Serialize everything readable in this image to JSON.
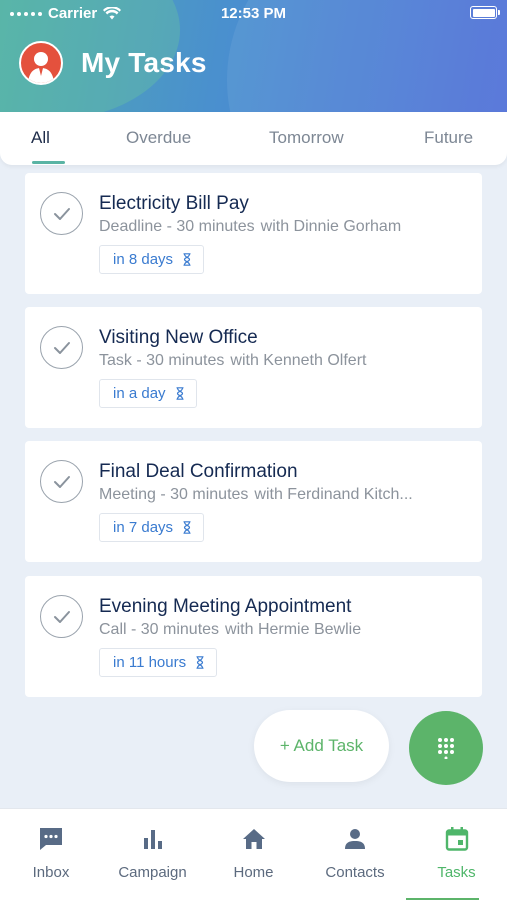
{
  "status_bar": {
    "carrier": "Carrier",
    "time": "12:53 PM"
  },
  "header": {
    "title": "My Tasks"
  },
  "tabs": [
    {
      "label": "All",
      "active": true
    },
    {
      "label": "Overdue",
      "active": false
    },
    {
      "label": "Tomorrow",
      "active": false
    },
    {
      "label": "Future",
      "active": false
    }
  ],
  "tasks": [
    {
      "title": "Electricity Bill Pay",
      "type_duration": "Deadline - 30 minutes",
      "with": "with Dinnie Gorham",
      "due": "in 8 days"
    },
    {
      "title": "Visiting New Office",
      "type_duration": "Task - 30 minutes",
      "with": "with Kenneth Olfert",
      "due": "in a day"
    },
    {
      "title": "Final  Deal Confirmation",
      "type_duration": "Meeting - 30 minutes",
      "with": "with Ferdinand Kitch...",
      "due": "in 7 days"
    },
    {
      "title": "Evening Meeting Appointment",
      "type_duration": "Call - 30 minutes",
      "with": "with Hermie Bewlie",
      "due": "in 11 hours"
    }
  ],
  "actions": {
    "add_task": "+ Add Task"
  },
  "bottom_nav": [
    {
      "label": "Inbox",
      "icon": "inbox-icon"
    },
    {
      "label": "Campaign",
      "icon": "bar-chart-icon"
    },
    {
      "label": "Home",
      "icon": "home-icon"
    },
    {
      "label": "Contacts",
      "icon": "person-icon"
    },
    {
      "label": "Tasks",
      "icon": "calendar-icon",
      "active": true
    }
  ],
  "colors": {
    "accent_green": "#5cb46a",
    "link_blue": "#3a7bd0",
    "title_navy": "#152a52"
  }
}
